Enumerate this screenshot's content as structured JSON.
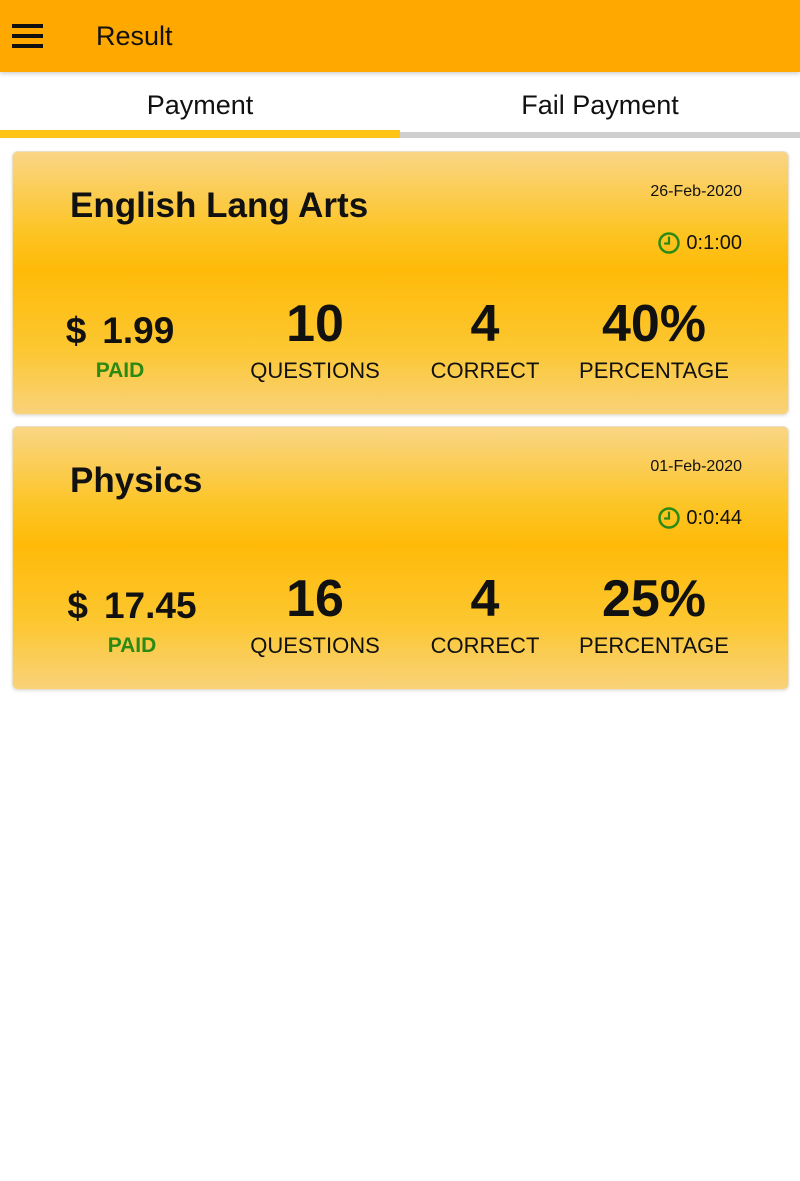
{
  "app_bar": {
    "title": "Result",
    "menu_icon": "hamburger-menu-icon",
    "background": "#FFA800"
  },
  "tabs": [
    {
      "label": "Payment",
      "active": true
    },
    {
      "label": "Fail Payment",
      "active": false
    }
  ],
  "results": [
    {
      "subject": "English Lang Arts",
      "date": "26-Feb-2020",
      "duration": "0:1:00",
      "currency": "$",
      "amount": "1.99",
      "status": "PAID",
      "questions": "10",
      "questions_label": "QUESTIONS",
      "correct": "4",
      "correct_label": "CORRECT",
      "percentage": "40%",
      "percentage_label": "PERCENTAGE"
    },
    {
      "subject": "Physics",
      "date": "01-Feb-2020",
      "duration": "0:0:44",
      "currency": "$",
      "amount": "17.45",
      "status": "PAID",
      "questions": "16",
      "questions_label": "QUESTIONS",
      "correct": "4",
      "correct_label": "CORRECT",
      "percentage": "25%",
      "percentage_label": "PERCENTAGE"
    }
  ],
  "colors": {
    "accent": "#FFC414",
    "paid": "#2B8A14",
    "clock": "#2B8A14"
  }
}
